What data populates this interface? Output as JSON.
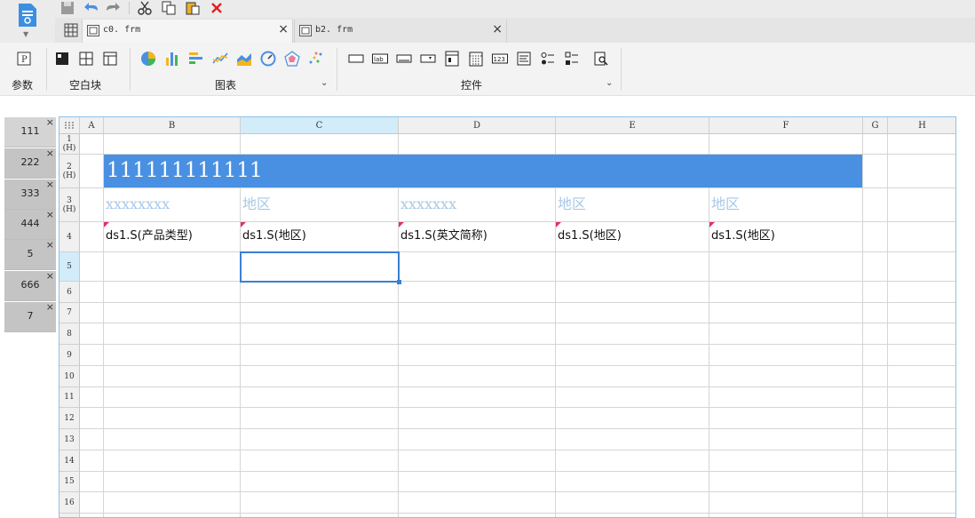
{
  "toolbar": {
    "quick": [
      "save-icon",
      "undo-icon",
      "redo-icon",
      "cut-icon",
      "copy-icon",
      "paste-icon",
      "delete-icon"
    ]
  },
  "tabs": [
    {
      "label": "c0. frm",
      "active": true
    },
    {
      "label": "b2. frm",
      "active": false
    }
  ],
  "ribbon": {
    "param_label": "参数",
    "blank_label": "空白块",
    "chart_label": "图表",
    "widget_label": "控件"
  },
  "sheets": [
    "111",
    "222",
    "333",
    "444",
    "5",
    "666",
    "7"
  ],
  "columns": [
    "A",
    "B",
    "C",
    "D",
    "E",
    "F",
    "G",
    "H"
  ],
  "rows": [
    "1 (H)",
    "2 (H)",
    "3 (H)",
    "4",
    "5",
    "6",
    "7",
    "8",
    "9",
    "10",
    "11",
    "12",
    "13",
    "14",
    "15",
    "16"
  ],
  "selected": {
    "column": "C",
    "row": "5"
  },
  "cells": {
    "banner": "111111111111",
    "b3": "xxxxxxxx",
    "c3": "地区",
    "d3": "xxxxxxx",
    "e3": "地区",
    "f3": "地区",
    "b4": "ds1.S(产品类型)",
    "c4": "ds1.S(地区)",
    "d4": "ds1.S(英文简称)",
    "e4": "ds1.S(地区)",
    "f4": "ds1.S(地区)"
  },
  "colors": {
    "accent": "#4a90e2",
    "selection": "#3a7fd6",
    "marker": "#e0306a"
  }
}
